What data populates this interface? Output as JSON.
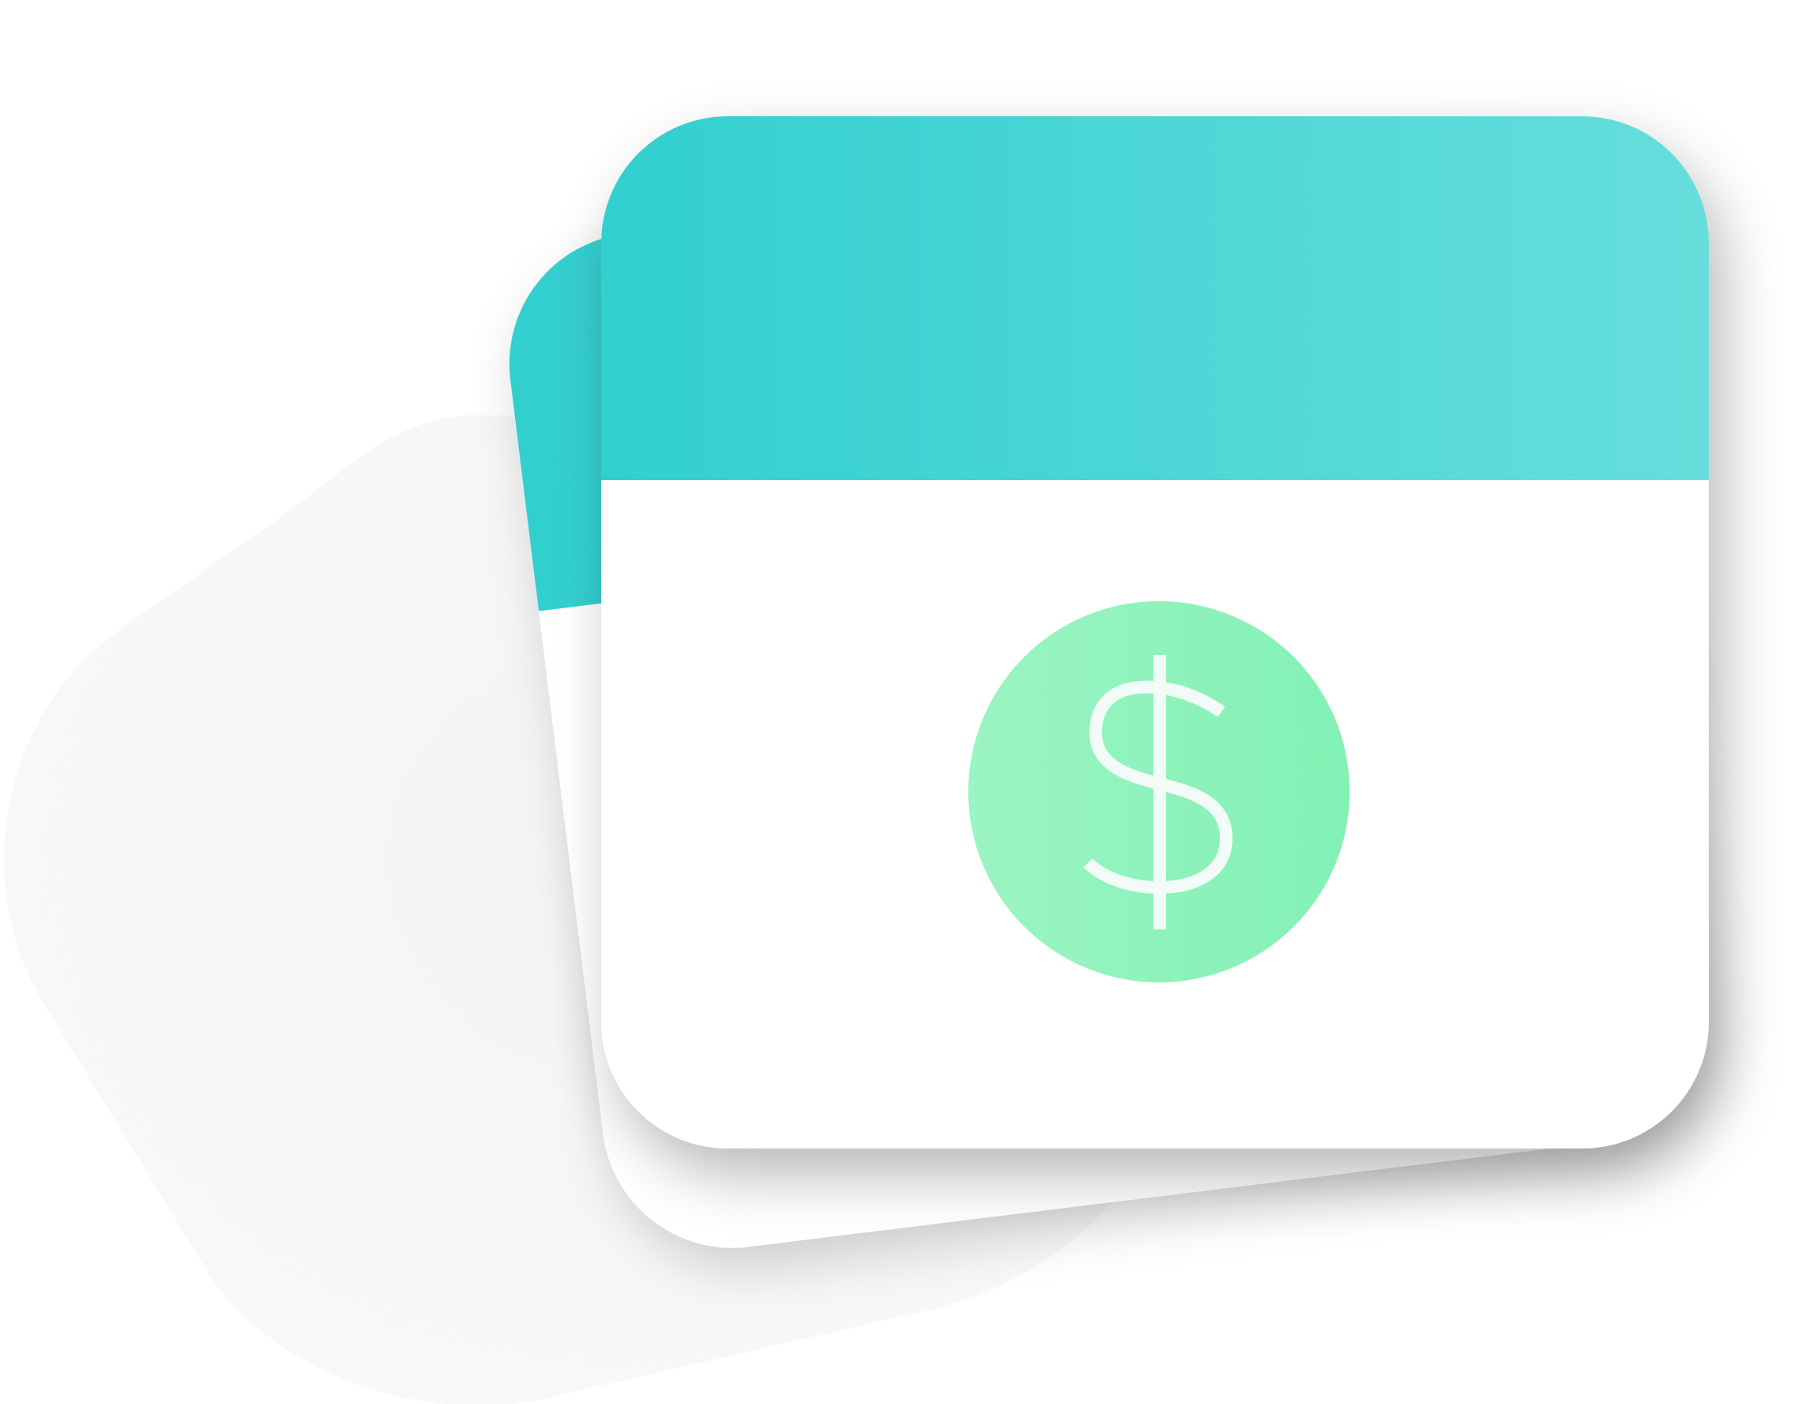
{
  "illustration": {
    "name": "calendar-payment",
    "symbol": "$",
    "colors": {
      "background": "#ffffff",
      "backdrop_blob": "#f7f8f8",
      "header_start": "#32cfcf",
      "header_end": "#66dedc",
      "card_body": "#ffffff",
      "coin_start": "#9bf4c3",
      "coin_end": "#82f1b4",
      "symbol": "#f2fbf7"
    }
  }
}
